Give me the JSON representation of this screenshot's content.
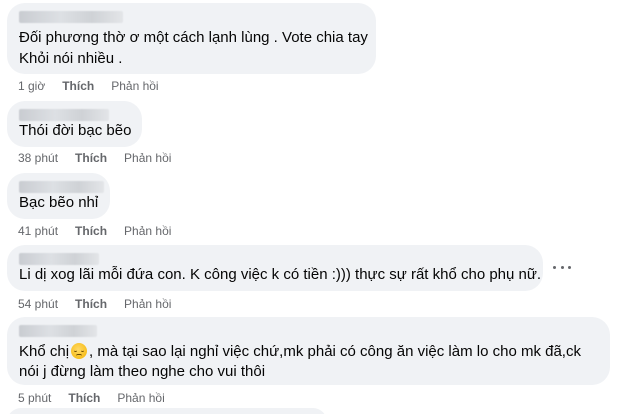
{
  "comments": [
    {
      "lines": [
        "Đối phương thờ ơ một cách lạnh lùng . Vote chia tay",
        "Khỏi nói nhiều ."
      ],
      "time": "1 giờ",
      "like": "Thích",
      "reply": "Phản hồi"
    },
    {
      "lines": [
        "Thói đời bạc bẽo"
      ],
      "time": "38 phút",
      "like": "Thích",
      "reply": "Phản hồi"
    },
    {
      "lines": [
        "Bạc bẽo nhỉ"
      ],
      "time": "41 phút",
      "like": "Thích",
      "reply": "Phản hồi"
    },
    {
      "lines": [
        "Li dị xog lãi mỗi đứa con. K công việc k có tiền :))) thực sự rất khổ cho phụ nữ."
      ],
      "time": "54 phút",
      "like": "Thích",
      "reply": "Phản hồi"
    },
    {
      "line1_before_emoji": "Khổ chị",
      "emoji": "pensive-face",
      "line1_after_emoji": ", mà tại sao lại nghỉ việc chứ,mk phải có công ăn việc làm lo cho mk đã,ck",
      "line2": "nói j đừng làm theo nghe cho vui thôi",
      "time": "5 phút",
      "like": "Thích",
      "reply": "Phản hồi"
    }
  ],
  "colors": {
    "bubble": "#f0f2f5",
    "text": "#050505",
    "meta": "#65676b"
  }
}
